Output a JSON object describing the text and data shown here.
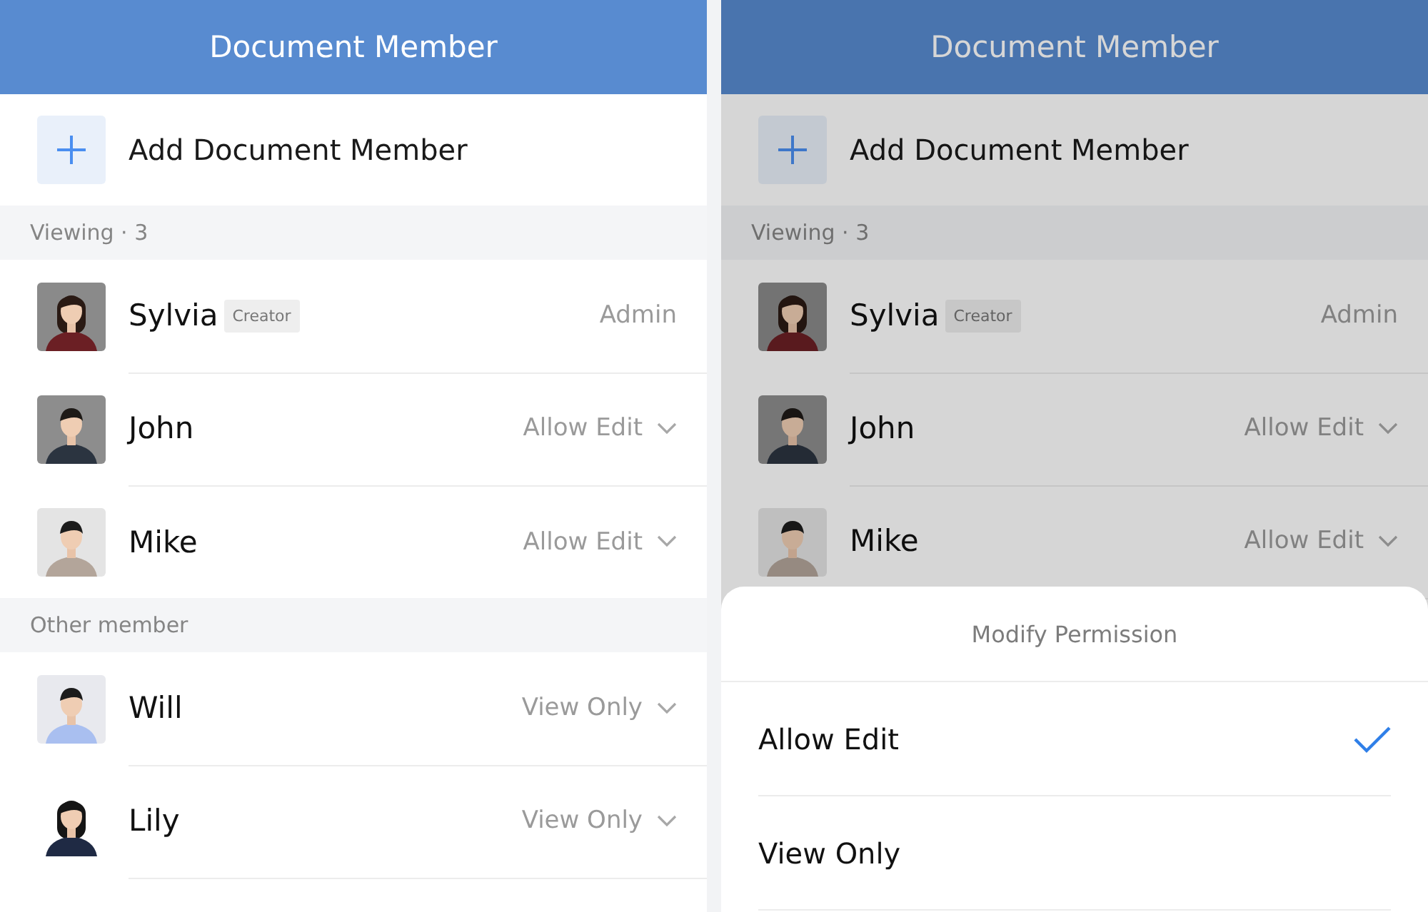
{
  "screens": [
    {
      "header": {
        "title": "Document Member"
      },
      "add_member": {
        "label": "Add Document Member"
      },
      "dimmed": false,
      "sections": [
        {
          "title": "Viewing · 3",
          "members": [
            {
              "name": "Sylvia",
              "badge": "Creator",
              "permission": "Admin",
              "dropdown": false
            },
            {
              "name": "John",
              "permission": "Allow Edit",
              "dropdown": true
            },
            {
              "name": "Mike",
              "permission": "Allow Edit",
              "dropdown": true
            }
          ]
        },
        {
          "title": "Other member",
          "members": [
            {
              "name": "Will",
              "permission": "View Only",
              "dropdown": true
            },
            {
              "name": "Lily",
              "permission": "View Only",
              "dropdown": true
            }
          ]
        }
      ]
    },
    {
      "header": {
        "title": "Document Member"
      },
      "add_member": {
        "label": "Add Document Member"
      },
      "dimmed": true,
      "sections": [
        {
          "title": "Viewing · 3",
          "members": [
            {
              "name": "Sylvia",
              "badge": "Creator",
              "permission": "Admin",
              "dropdown": false
            },
            {
              "name": "John",
              "permission": "Allow Edit",
              "dropdown": true
            },
            {
              "name": "Mike",
              "permission": "Allow Edit",
              "dropdown": true
            }
          ]
        }
      ],
      "sheet": {
        "title": "Modify Permission",
        "options": [
          {
            "label": "Allow Edit",
            "selected": true
          },
          {
            "label": "View Only",
            "selected": false
          }
        ]
      }
    }
  ]
}
